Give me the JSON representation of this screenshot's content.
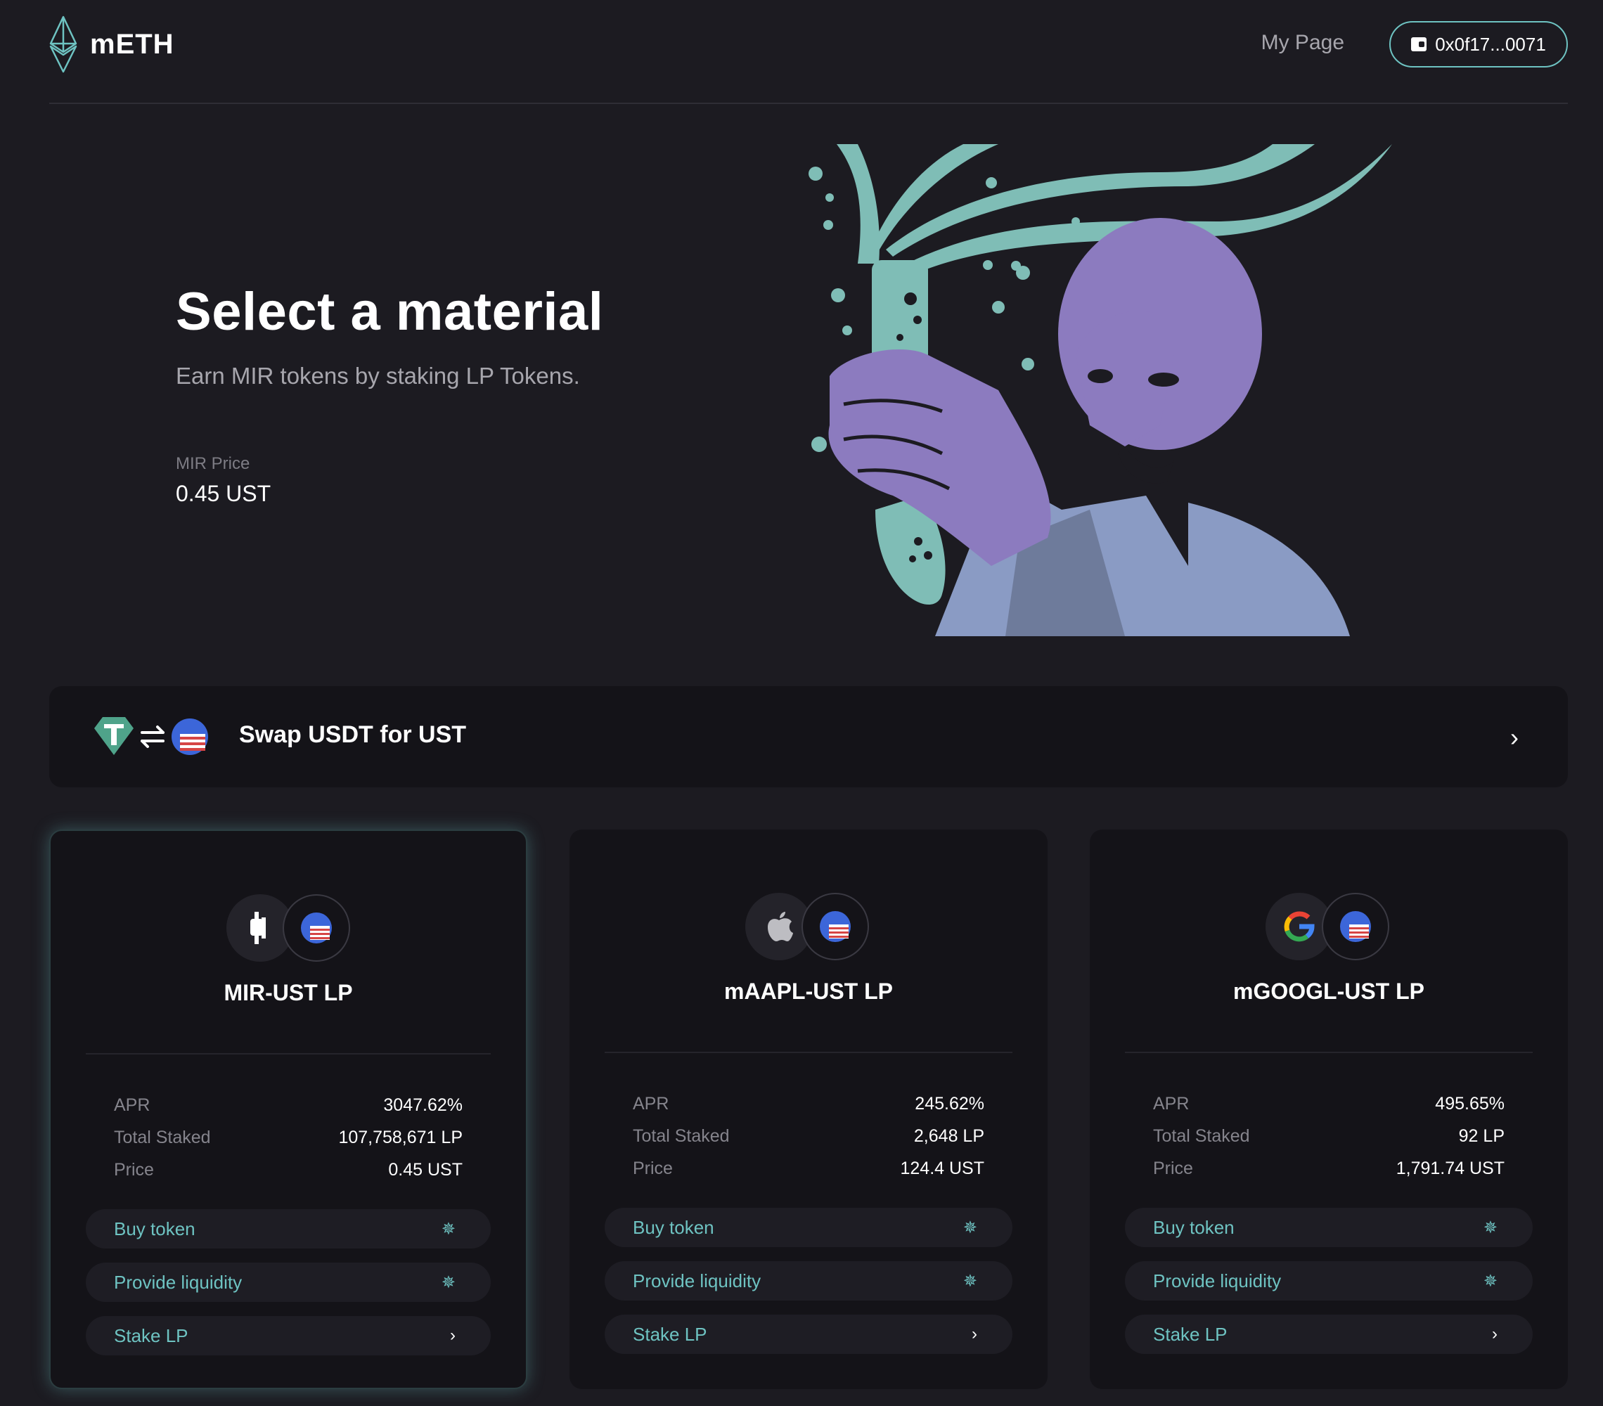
{
  "header": {
    "logo_text": "mETH",
    "my_page": "My Page",
    "wallet_address": "0x0f17...0071"
  },
  "hero": {
    "title": "Select a material",
    "subtitle": "Earn MIR tokens by staking LP Tokens.",
    "price_label": "MIR Price",
    "price_value": "0.45 UST"
  },
  "swap": {
    "label": "Swap USDT for UST",
    "from_icon": "tether-icon",
    "arrows_icon": "swap-arrows-icon",
    "to_icon": "ust-icon"
  },
  "colors": {
    "background": "#1c1b21",
    "card": "#141318",
    "accent": "#6ec3c2",
    "illustration_purple": "#8c7bbf",
    "muted_text": "#85848c"
  },
  "cards": [
    {
      "title": "MIR-UST LP",
      "token_icon": "mir-icon",
      "pair_icon": "ust-icon",
      "apr_label": "APR",
      "apr": "3047.62%",
      "staked_label": "Total Staked",
      "staked": "107,758,671 LP",
      "price_label": "Price",
      "price": "0.45 UST",
      "buy_label": "Buy token",
      "liquidity_label": "Provide liquidity",
      "stake_label": "Stake LP"
    },
    {
      "title": "mAAPL-UST LP",
      "token_icon": "apple-icon",
      "pair_icon": "ust-icon",
      "apr_label": "APR",
      "apr": "245.62%",
      "staked_label": "Total Staked",
      "staked": "2,648 LP",
      "price_label": "Price",
      "price": "124.4 UST",
      "buy_label": "Buy token",
      "liquidity_label": "Provide liquidity",
      "stake_label": "Stake LP"
    },
    {
      "title": "mGOOGL-UST LP",
      "token_icon": "google-icon",
      "pair_icon": "ust-icon",
      "apr_label": "APR",
      "apr": "495.65%",
      "staked_label": "Total Staked",
      "staked": "92 LP",
      "price_label": "Price",
      "price": "1,791.74 UST",
      "buy_label": "Buy token",
      "liquidity_label": "Provide liquidity",
      "stake_label": "Stake LP"
    }
  ]
}
